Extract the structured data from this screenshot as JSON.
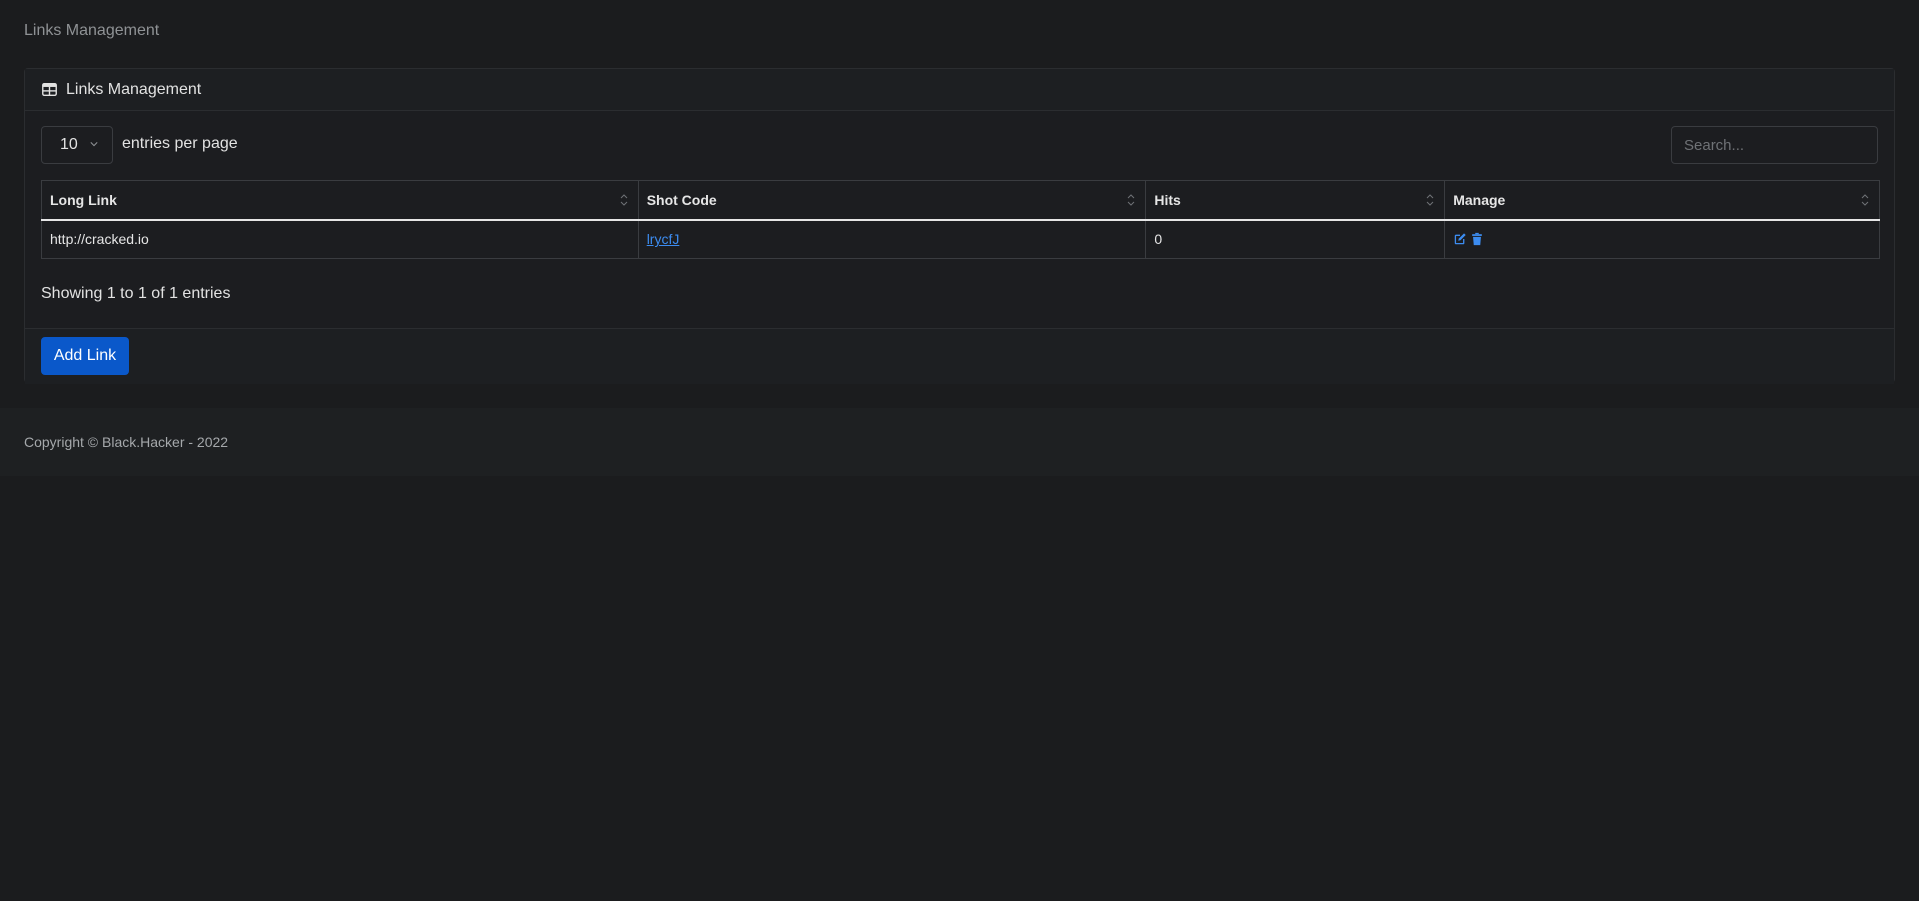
{
  "breadcrumb": "Links Management",
  "card": {
    "title": "Links Management",
    "title_icon": "table-icon"
  },
  "controls": {
    "per_page_value": "10",
    "per_page_label": "entries per page",
    "search_placeholder": "Search..."
  },
  "table": {
    "headers": [
      "Long Link",
      "Shot Code",
      "Hits",
      "Manage"
    ],
    "rows": [
      {
        "long_link": "http://cracked.io",
        "shot_code": "lrycfJ",
        "hits": "0",
        "manage_icons": [
          "edit-icon",
          "trash-icon"
        ]
      }
    ]
  },
  "showing_text": "Showing 1 to 1 of 1 entries",
  "add_button_label": "Add Link",
  "footer_text": "Copyright © Black.Hacker - 2022",
  "colors": {
    "background": "#1b1c1e",
    "link": "#3c8cf0",
    "primary_button": "#0a58ca"
  }
}
